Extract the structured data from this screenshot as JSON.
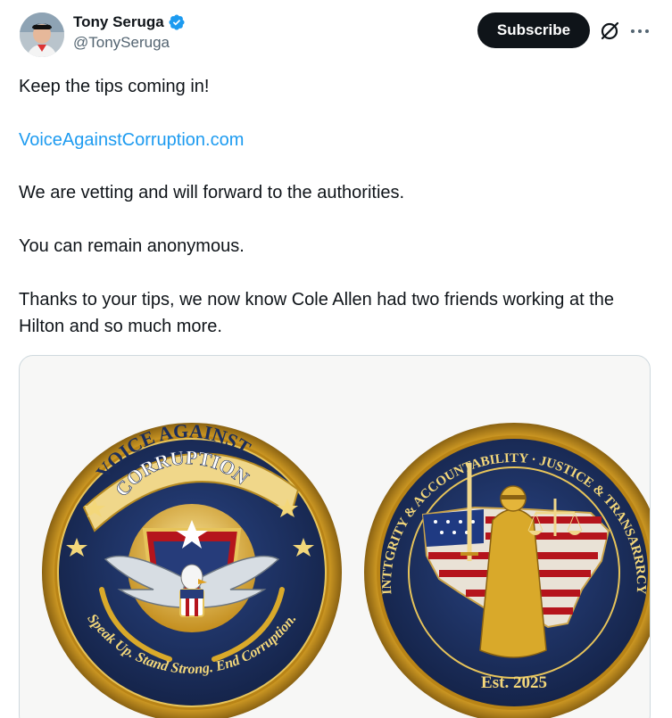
{
  "author": {
    "name": "Tony Seruga",
    "handle": "@TonySeruga",
    "verified_icon": "verified-badge-icon"
  },
  "actions": {
    "subscribe_label": "Subscribe",
    "grok_icon": "grok-icon",
    "more_icon": "more-options-icon"
  },
  "tweet": {
    "line1": "Keep the tips coming in!",
    "link": "VoiceAgainstCorruption.com",
    "line3": "We are vetting and will forward to the authorities.",
    "line4": "You can remain anonymous.",
    "line5": "Thanks to your tips, we now know Cole Allen had two friends working at the Hilton and so much more."
  },
  "media": {
    "left_coin": {
      "title_top": "VOICE AGAINST",
      "title_bottom": "CORRUPTION",
      "motto": "Speak Up. Stand Strong. End Corruption."
    },
    "right_coin": {
      "ring_text": "INTTGRITY & ACCOUNTABILITY · JUSTICE & TRANSARRRCY",
      "established": "Est. 2025"
    }
  },
  "colors": {
    "accent_link": "#1d9bf0",
    "verified": "#1d9bf0",
    "coin_navy": "#1b2d5c",
    "coin_gold": "#d9a92a"
  }
}
